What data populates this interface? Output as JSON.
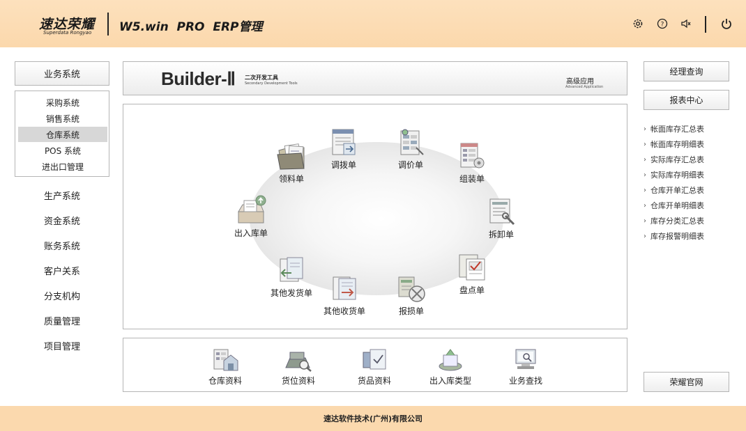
{
  "header": {
    "logo_cn": "速达荣耀",
    "logo_en": "Superdata Rongyao",
    "product_title": "W5.win  PRO  ERP管理",
    "icons": [
      "gear-icon",
      "help-icon",
      "speaker-icon",
      "power-icon"
    ]
  },
  "left_nav": {
    "business": "业务系统",
    "sub_items": [
      "采购系统",
      "销售系统",
      "仓库系统",
      "POS 系统",
      "进出口管理"
    ],
    "active_sub": "仓库系统",
    "items": [
      "生产系统",
      "资金系统",
      "账务系统",
      "客户关系",
      "分支机构",
      "质量管理",
      "项目管理"
    ]
  },
  "banner": {
    "title": "Builder-Ⅱ",
    "sub_cn": "二次开发工具",
    "sub_en": "Secondary Development Tools",
    "adv_cn": "高级应用",
    "adv_en": "Advanced Application"
  },
  "diagram": {
    "nodes": [
      {
        "label": "领料单",
        "icon": "folder-docs-icon"
      },
      {
        "label": "调拨单",
        "icon": "transfer-doc-icon"
      },
      {
        "label": "调价单",
        "icon": "price-adjust-icon"
      },
      {
        "label": "组装单",
        "icon": "assembly-icon"
      },
      {
        "label": "出入库单",
        "icon": "inout-box-icon"
      },
      {
        "label": "拆卸单",
        "icon": "disassembly-icon"
      },
      {
        "label": "其他发货单",
        "icon": "other-ship-icon"
      },
      {
        "label": "盘点单",
        "icon": "stocktake-icon"
      },
      {
        "label": "其他收货单",
        "icon": "other-receive-icon"
      },
      {
        "label": "报损单",
        "icon": "damage-report-icon"
      }
    ]
  },
  "bottom_tools": [
    {
      "label": "仓库资料",
      "icon": "warehouse-icon"
    },
    {
      "label": "货位资料",
      "icon": "location-icon"
    },
    {
      "label": "货品资料",
      "icon": "goods-icon"
    },
    {
      "label": "出入库类型",
      "icon": "inout-type-icon"
    },
    {
      "label": "业务查找",
      "icon": "search-monitor-icon"
    }
  ],
  "right_panel": {
    "manager_query": "经理查询",
    "report_center": "报表中心",
    "links": [
      "帐面库存汇总表",
      "帐面库存明细表",
      "实际库存汇总表",
      "实际库存明细表",
      "仓库开单汇总表",
      "仓库开单明细表",
      "库存分类汇总表",
      "库存报警明细表"
    ],
    "official_site": "荣耀官网"
  },
  "footer": {
    "text": "速达软件技术(广州)有限公司"
  }
}
